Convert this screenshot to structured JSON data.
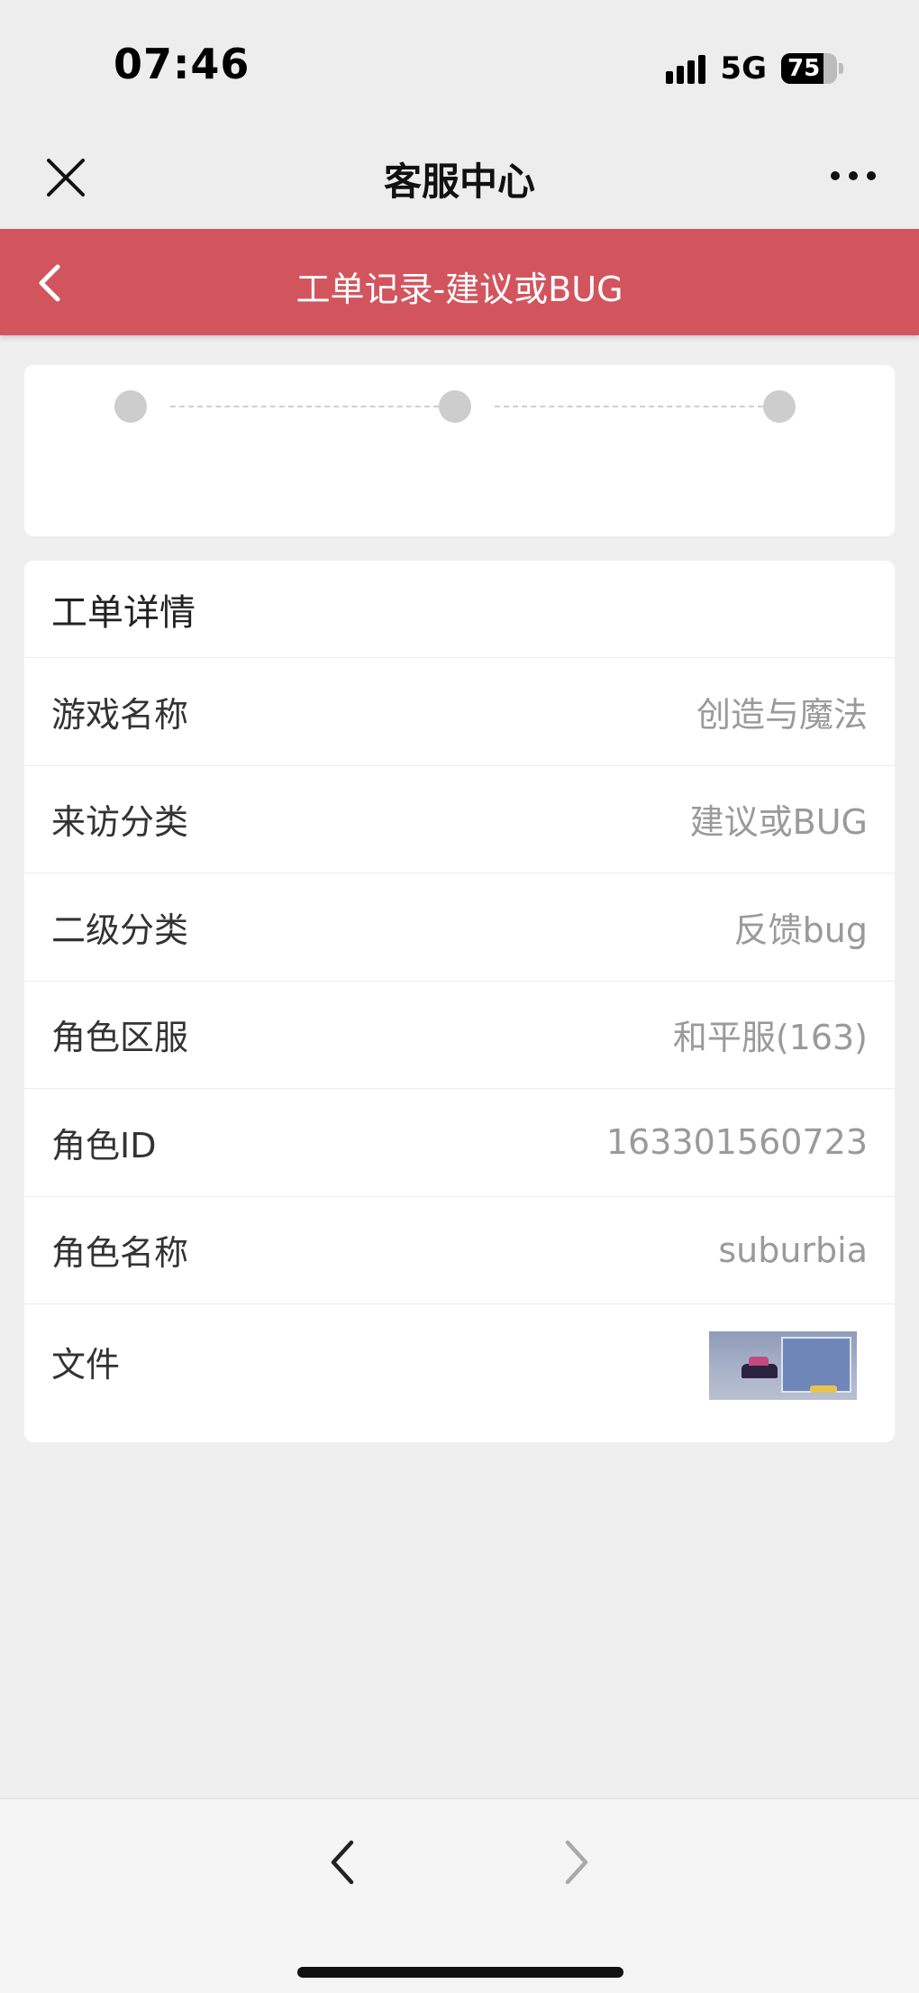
{
  "status_bar": {
    "time": "07:46",
    "network": "5G",
    "battery": "75"
  },
  "nav": {
    "title": "客服中心"
  },
  "header": {
    "title": "工单记录-建议或BUG"
  },
  "progress": {
    "steps": 3,
    "current_step": 0
  },
  "detail": {
    "heading": "工单详情",
    "rows": [
      {
        "label": "游戏名称",
        "value": "创造与魔法"
      },
      {
        "label": "来访分类",
        "value": "建议或BUG"
      },
      {
        "label": "二级分类",
        "value": "反馈bug"
      },
      {
        "label": "角色区服",
        "value": "和平服(163)"
      },
      {
        "label": "角色ID",
        "value": "163301560723"
      },
      {
        "label": "角色名称",
        "value": "suburbia"
      }
    ],
    "file_label": "文件"
  },
  "colors": {
    "header_red": "#d2555e",
    "background": "#efeff0",
    "card": "#ffffff"
  }
}
